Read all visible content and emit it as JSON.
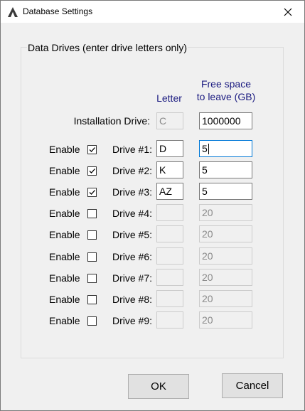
{
  "window": {
    "title": "Database Settings"
  },
  "group": {
    "legend": "Data Drives (enter drive letters only)"
  },
  "headers": {
    "letter": "Letter",
    "free_space_line1": "Free space",
    "free_space_line2": "to leave (GB)"
  },
  "installation": {
    "label": "Installation Drive:",
    "letter": "C",
    "free_space": "1000000"
  },
  "drives": [
    {
      "enable_label": "Enable",
      "checked": true,
      "label": "Drive #1:",
      "letter": "D",
      "free_space": "5",
      "enabled": true,
      "focused": true
    },
    {
      "enable_label": "Enable",
      "checked": true,
      "label": "Drive #2:",
      "letter": "K",
      "free_space": "5",
      "enabled": true,
      "focused": false
    },
    {
      "enable_label": "Enable",
      "checked": true,
      "label": "Drive #3:",
      "letter": "AZ",
      "free_space": "5",
      "enabled": true,
      "focused": false
    },
    {
      "enable_label": "Enable",
      "checked": false,
      "label": "Drive #4:",
      "letter": "",
      "free_space": "20",
      "enabled": false,
      "focused": false
    },
    {
      "enable_label": "Enable",
      "checked": false,
      "label": "Drive #5:",
      "letter": "",
      "free_space": "20",
      "enabled": false,
      "focused": false
    },
    {
      "enable_label": "Enable",
      "checked": false,
      "label": "Drive #6:",
      "letter": "",
      "free_space": "20",
      "enabled": false,
      "focused": false
    },
    {
      "enable_label": "Enable",
      "checked": false,
      "label": "Drive #7:",
      "letter": "",
      "free_space": "20",
      "enabled": false,
      "focused": false
    },
    {
      "enable_label": "Enable",
      "checked": false,
      "label": "Drive #8:",
      "letter": "",
      "free_space": "20",
      "enabled": false,
      "focused": false
    },
    {
      "enable_label": "Enable",
      "checked": false,
      "label": "Drive #9:",
      "letter": "",
      "free_space": "20",
      "enabled": false,
      "focused": false
    }
  ],
  "buttons": {
    "ok": "OK",
    "cancel": "Cancel"
  }
}
